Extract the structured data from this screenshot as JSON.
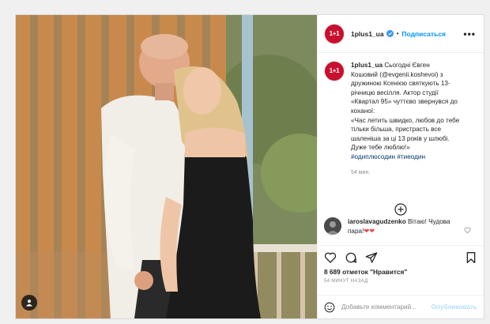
{
  "header": {
    "avatar_label": "1+1",
    "username": "1plus1_ua",
    "follow_label": "Подписаться",
    "separator": "•",
    "more_label": "•••"
  },
  "caption": {
    "username": "1plus1_ua",
    "lines": [
      "Сьогодні Євген",
      "Кошовий (@evgenii.koshevoi) з",
      "дружиною Ксенією святкують 13-",
      "річницю весілля. Актор студії",
      "«Квартал 95» чуттєво звернувся до",
      "коханої:",
      "«Час летить швидко, любов до тебе",
      "тільки більша, пристрасть все",
      "шаленіша за ці 13 років у шлюбі.",
      "Дуже тебе люблю!»",
      "#одиплюсодин #тиеодин"
    ],
    "time": "54 мин."
  },
  "comment": {
    "username": "iaroslavagudzenko",
    "text": "Вітаю! Чудова пара!",
    "emoji": "❤❤"
  },
  "stats": {
    "likes": "8 689 отметок \"Нравится\"",
    "posted": "54 МИНУТ НАЗАД"
  },
  "comment_box": {
    "placeholder": "Добавьте комментарий...",
    "publish_label": "Опубликовать"
  },
  "icons": {
    "verified": "verified-badge-icon",
    "more": "more-options-icon",
    "add_comment": "plus-circle-icon",
    "like": "heart-icon",
    "comment": "comment-icon",
    "share": "paper-plane-icon",
    "save": "bookmark-icon",
    "emoji": "smiley-icon",
    "user_tag": "user-tag-icon"
  },
  "colors": {
    "accent": "#0095f6",
    "brand_red": "#c8102e",
    "heart": "#ed4956"
  }
}
